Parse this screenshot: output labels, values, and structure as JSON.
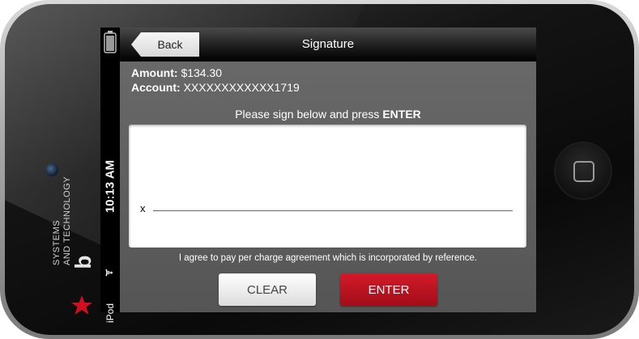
{
  "device": {
    "brand_text_line1": "SYSTEMS",
    "brand_text_line2": "AND TECHNOLOGY",
    "brand_letter": "b"
  },
  "statusbar": {
    "time": "10:13 AM",
    "carrier": "iPod"
  },
  "navbar": {
    "back_label": "Back",
    "title": "Signature"
  },
  "transaction": {
    "amount_label": "Amount:",
    "amount_value": "$134.30",
    "account_label": "Account:",
    "account_value": "XXXXXXXXXXXX1719"
  },
  "signature": {
    "instruction_prefix": "Please sign below and press",
    "instruction_keyword": "ENTER",
    "x_mark": "x",
    "agreement": "I agree to pay per charge agreement which is incorporated by reference."
  },
  "buttons": {
    "clear_label": "CLEAR",
    "enter_label": "ENTER"
  },
  "colors": {
    "enter_red": "#c0121f",
    "brand_red": "#d0101e"
  },
  "icons": {
    "battery": "battery-icon",
    "wifi": "wifi-icon",
    "star": "star-icon",
    "home": "home-button-icon"
  }
}
